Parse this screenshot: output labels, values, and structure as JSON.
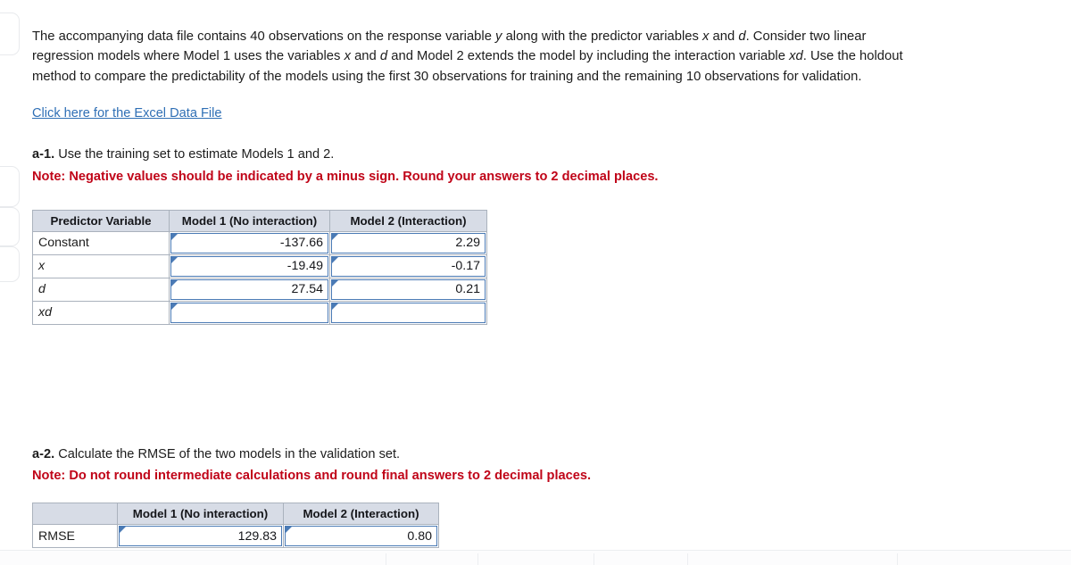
{
  "problem": {
    "intro_segments": [
      {
        "t": "The accompanying data file contains 40 observations on the response variable ",
        "i": false
      },
      {
        "t": "y",
        "i": true
      },
      {
        "t": " along with the predictor variables ",
        "i": false
      },
      {
        "t": "x",
        "i": true
      },
      {
        "t": " and ",
        "i": false
      },
      {
        "t": "d",
        "i": true
      },
      {
        "t": ". Consider two linear regression models where Model 1 uses the variables ",
        "i": false
      },
      {
        "t": "x",
        "i": true
      },
      {
        "t": " and ",
        "i": false
      },
      {
        "t": "d",
        "i": true
      },
      {
        "t": " and Model 2 extends the model by including the interaction variable ",
        "i": false
      },
      {
        "t": "xd",
        "i": true
      },
      {
        "t": ". Use the holdout method to compare the predictability of the models using the first 30 observations for training and the remaining 10 observations for validation.",
        "i": false
      }
    ],
    "data_file_link": "Click here for the Excel Data File"
  },
  "part_a1": {
    "label": "a-1.",
    "prompt": "Use the training set to estimate Models 1 and 2.",
    "note": "Note: Negative values should be indicated by a minus sign. Round your answers to 2 decimal places.",
    "table": {
      "headers": [
        "Predictor Variable",
        "Model 1 (No interaction)",
        "Model 2 (Interaction)"
      ],
      "rows": [
        {
          "label": "Constant",
          "italic": false,
          "model1": "-137.66",
          "model2": "2.29"
        },
        {
          "label": "x",
          "italic": true,
          "model1": "-19.49",
          "model2": "-0.17"
        },
        {
          "label": "d",
          "italic": true,
          "model1": "27.54",
          "model2": "0.21"
        },
        {
          "label": "xd",
          "italic": true,
          "model1": "",
          "model2": ""
        }
      ]
    }
  },
  "part_a2": {
    "label": "a-2.",
    "prompt": "Calculate the RMSE of the two models in the validation set.",
    "note": "Note: Do not round intermediate calculations and round final answers to 2 decimal places.",
    "table": {
      "headers": [
        "",
        "Model 1 (No interaction)",
        "Model 2 (Interaction)"
      ],
      "rows": [
        {
          "label": "RMSE",
          "italic": false,
          "model1": "129.83",
          "model2": "0.80"
        }
      ]
    }
  },
  "colors": {
    "link": "#2f6fb5",
    "note_red": "#c00418",
    "header_fill": "#d7dce6",
    "input_border": "#4a7ab5",
    "grid_border": "#aab2bd"
  }
}
